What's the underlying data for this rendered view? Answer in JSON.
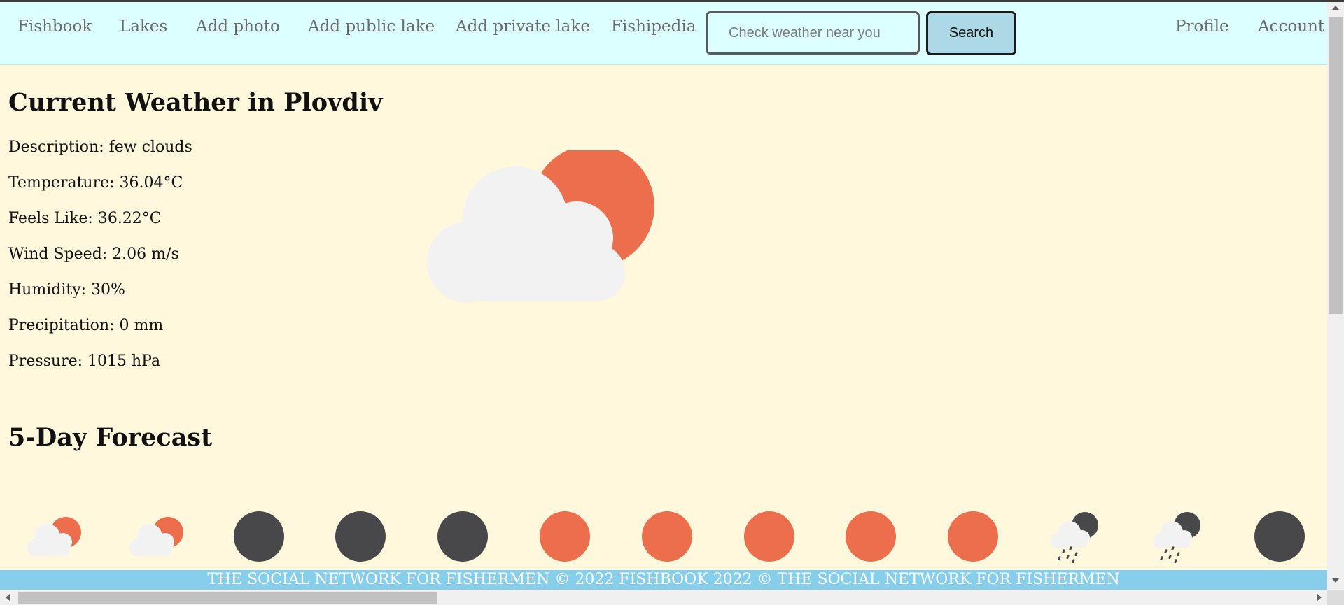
{
  "nav": {
    "links": [
      "Fishbook",
      "Lakes",
      "Add photo",
      "Add public lake",
      "Add private lake",
      "Fishipedia"
    ],
    "right_links": [
      "Profile",
      "Account"
    ],
    "search_placeholder": "Check weather near you",
    "search_button": "Search"
  },
  "current": {
    "title": "Current Weather in Plovdiv",
    "details": [
      "Description: few clouds",
      "Temperature: 36.04°C",
      "Feels Like: 36.22°C",
      "Wind Speed: 2.06 m/s",
      "Humidity: 30%",
      "Precipitation: 0 mm",
      "Pressure: 1015 hPa"
    ],
    "icon": "few-clouds-day-icon"
  },
  "forecast": {
    "title": "5-Day Forecast",
    "icons": [
      "few-clouds-day-icon",
      "few-clouds-day-icon",
      "clear-night-icon",
      "clear-night-icon",
      "clear-night-icon",
      "clear-day-icon",
      "clear-day-icon",
      "clear-day-icon",
      "clear-day-icon",
      "clear-day-icon",
      "rain-night-icon",
      "rain-night-icon",
      "clear-night-icon"
    ]
  },
  "footer": {
    "text": "THE SOCIAL NETWORK FOR FISHERMEN © 2022 FISHBOOK 2022 © THE SOCIAL NETWORK FOR FISHERMEN"
  },
  "colors": {
    "page_bg": "#fff8dc",
    "nav_bg": "#dcffff",
    "footer_bg": "#87ceeb",
    "search_button_bg": "#add8e6",
    "sun": "#ec6e4c",
    "moon": "#48484a",
    "cloud": "#f2f2f2"
  }
}
